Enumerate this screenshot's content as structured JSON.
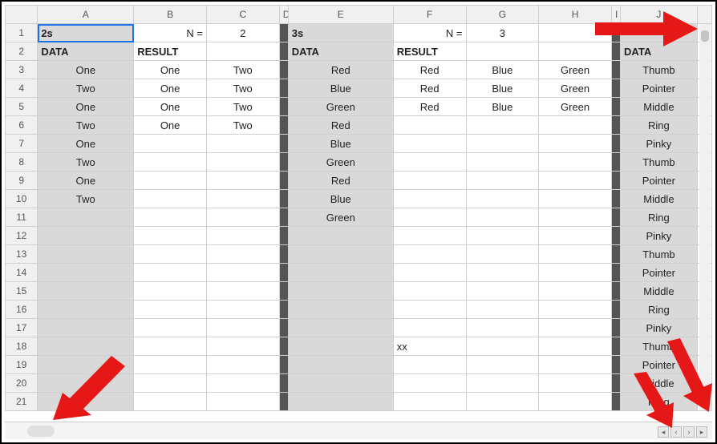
{
  "columns": [
    "A",
    "B",
    "C",
    "D",
    "E",
    "F",
    "G",
    "H",
    "I",
    "J"
  ],
  "rows": [
    "1",
    "2",
    "3",
    "4",
    "5",
    "6",
    "7",
    "8",
    "9",
    "10",
    "11",
    "12",
    "13",
    "14",
    "15",
    "16",
    "17",
    "18",
    "19",
    "20",
    "21"
  ],
  "selected_cell": "A1",
  "cells": {
    "A1": "2s",
    "B1": "N =",
    "C1": "2",
    "E1": "3s",
    "F1": "N =",
    "G1": "3",
    "A2": "DATA",
    "B2": "RESULT",
    "E2": "DATA",
    "F2": "RESULT",
    "J2": "DATA",
    "A3": "One",
    "B3": "One",
    "C3": "Two",
    "E3": "Red",
    "F3": "Red",
    "G3": "Blue",
    "H3": "Green",
    "J3": "Thumb",
    "A4": "Two",
    "B4": "One",
    "C4": "Two",
    "E4": "Blue",
    "F4": "Red",
    "G4": "Blue",
    "H4": "Green",
    "J4": "Pointer",
    "A5": "One",
    "B5": "One",
    "C5": "Two",
    "E5": "Green",
    "F5": "Red",
    "G5": "Blue",
    "H5": "Green",
    "J5": "Middle",
    "A6": "Two",
    "B6": "One",
    "C6": "Two",
    "E6": "Red",
    "J6": "Ring",
    "A7": "One",
    "E7": "Blue",
    "J7": "Pinky",
    "A8": "Two",
    "E8": "Green",
    "J8": "Thumb",
    "A9": "One",
    "E9": "Red",
    "J9": "Pointer",
    "A10": "Two",
    "E10": "Blue",
    "J10": "Middle",
    "E11": "Green",
    "J11": "Ring",
    "J12": "Pinky",
    "J13": "Thumb",
    "J14": "Pointer",
    "J15": "Middle",
    "J16": "Ring",
    "J17": "Pinky",
    "F18": "xx",
    "J18": "Thumb",
    "J19": "Pointer",
    "J20": "Middle",
    "J21": "Ring"
  },
  "gray_cols": [
    "A",
    "E",
    "J"
  ],
  "dark_cols": [
    "D",
    "I"
  ],
  "bold_cells": [
    "A1",
    "A2",
    "B2",
    "E1",
    "E2",
    "F2",
    "J2"
  ],
  "right_cells": [
    "B1",
    "F1"
  ],
  "left_cells": [
    "A1",
    "A2",
    "B2",
    "E1",
    "E2",
    "F2",
    "J2",
    "F18"
  ]
}
